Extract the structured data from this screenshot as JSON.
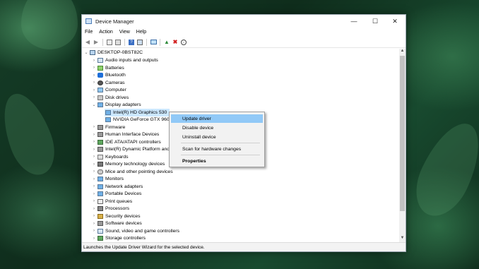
{
  "window": {
    "title": "Device Manager",
    "minimize": "—",
    "maximize": "☐",
    "close": "✕"
  },
  "menubar": [
    "File",
    "Action",
    "View",
    "Help"
  ],
  "toolbar": [
    "back-icon",
    "forward-icon",
    "properties-icon",
    "details-icon",
    "help-icon",
    "resources-icon",
    "monitor-icon",
    "update-driver-icon",
    "uninstall-icon",
    "download-icon"
  ],
  "tree": {
    "root": "DESKTOP-0BST82C",
    "categories": [
      "Audio inputs and outputs",
      "Batteries",
      "Bluetooth",
      "Cameras",
      "Computer",
      "Disk drives",
      "Display adapters",
      "Firmware",
      "Human Interface Devices",
      "IDE ATA/ATAPI controllers",
      "Intel(R) Dynamic Platform and Thermal Framework",
      "Keyboards",
      "Memory technology devices",
      "Mice and other pointing devices",
      "Monitors",
      "Network adapters",
      "Portable Devices",
      "Print queues",
      "Processors",
      "Security devices",
      "Software devices",
      "Sound, video and game controllers",
      "Storage controllers"
    ],
    "display_children": [
      "Intel(R) HD Graphics 530",
      "NVIDIA GeForce GTX 960M"
    ]
  },
  "context_menu": {
    "update": "Update driver",
    "disable": "Disable device",
    "uninstall": "Uninstall device",
    "scan": "Scan for hardware changes",
    "properties": "Properties"
  },
  "status": "Launches the Update Driver Wizard for the selected device.",
  "colors": {
    "selection": "#cce8ff",
    "menu_highlight": "#91c9f7"
  }
}
